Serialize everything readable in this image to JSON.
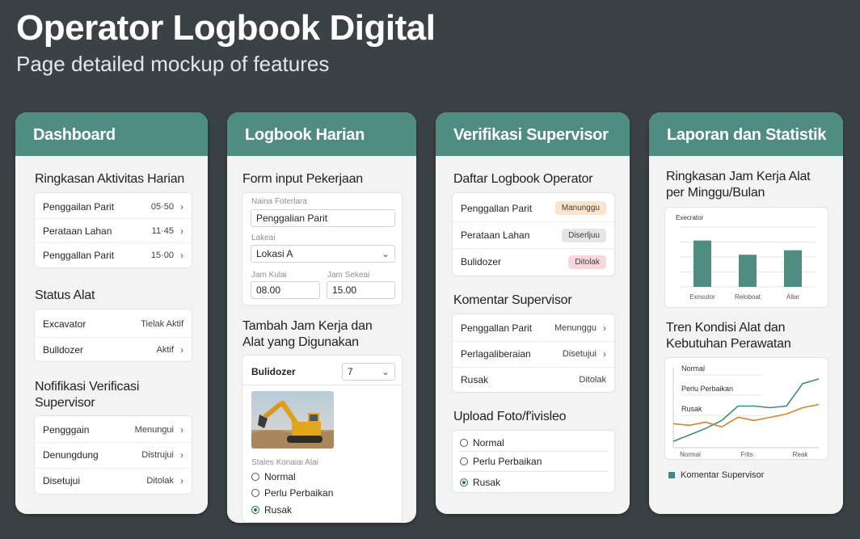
{
  "hero": {
    "title": "Operator Logbook Digital",
    "subtitle": "Page detailed mockup of features"
  },
  "colors": {
    "accent": "#4f8d83",
    "background": "#3b4245",
    "orange": "#d9822b"
  },
  "dashboard": {
    "header": "Dashboard",
    "activity_title": "Ringkasan Aktivitas Harian",
    "activities": [
      {
        "name": "Penggailan Parit",
        "value": "05·50"
      },
      {
        "name": "Perataan Lahan",
        "value": "11·45"
      },
      {
        "name": "Penggallan Parit",
        "value": "15·00"
      }
    ],
    "status_title": "Status Alat",
    "statuses": [
      {
        "name": "Excavator",
        "value": "Tielak Aktif"
      },
      {
        "name": "Bulldozer",
        "value": "Aktif"
      }
    ],
    "notif_title": "Nofifikasi Verificasi Supervisor",
    "notifs": [
      {
        "name": "Pengggain",
        "value": "Menungui"
      },
      {
        "name": "Denungdung",
        "value": "Distrujui"
      },
      {
        "name": "Disetujui",
        "value": "Ditolak"
      }
    ]
  },
  "logbook": {
    "header": "Logbook Harian",
    "form_title": "Form input Pekerjaan",
    "job_label": "Naina Foterlara",
    "job_value": "Penggalian Parit",
    "location_label": "Lakeai",
    "location_value": "Lokasi A",
    "start_label": "Jam Kulai",
    "start_value": "08.00",
    "end_label": "Jam Sekeai",
    "end_value": "15.00",
    "equip_title": "Tambah Jam Kerja dan Alat yang Digunakan",
    "equip_name": "Bulidozer",
    "equip_hours": "7",
    "condition_label": "Stales Konaiai Alai",
    "conditions": [
      "Normal",
      "Perlu Perbaikan",
      "Rusak"
    ],
    "condition_selected": 2
  },
  "verifikasi": {
    "header": "Verifikasi Supervisor",
    "list_title": "Daftar Logbook Operator",
    "items": [
      {
        "name": "Penggallan Parit",
        "badge": "Manunggu",
        "color": "#fbe3cc"
      },
      {
        "name": "Perataan Lahan",
        "badge": "Diserljuu",
        "color": "#e4e6e7"
      },
      {
        "name": "Bulidozer",
        "badge": "Ditolak",
        "color": "#f8d7dc"
      }
    ],
    "comment_title": "Komentar Supervisor",
    "comments": [
      {
        "name": "Penggallan Parit",
        "value": "Menunggu",
        "chevron": true
      },
      {
        "name": "Perlagaliberaian",
        "value": "Disetujui",
        "chevron": true
      },
      {
        "name": "Rusak",
        "value": "Ditolak",
        "chevron": false
      }
    ],
    "upload_title": "Upload Foto/f'ivisleo",
    "upload_options": [
      "Normal",
      "Perlu Perbaikan",
      "Rusak"
    ],
    "upload_selected": 2
  },
  "laporan": {
    "header": "Laporan dan Statistik",
    "bar_title": "Ringkasan Jam Kerja Alat per Minggu/Bulan",
    "trend_title": "Tren Kondisi Alat dan Kebutuhan Perawatan",
    "legend": "Komentar Supervisor"
  },
  "chart_data": [
    {
      "type": "bar",
      "title": "Execrator",
      "categories": [
        "Exnsutor",
        "Reloboat",
        "Allar"
      ],
      "values": [
        62,
        43,
        49
      ],
      "ylim": [
        0,
        80
      ],
      "grid": true
    },
    {
      "type": "line",
      "categories": [
        "Normal",
        "Frits",
        "Reak"
      ],
      "y_labels": [
        "Normal",
        "Perlu Perbaikan",
        "Rusak"
      ],
      "x": [
        0,
        1,
        2,
        3,
        4,
        5,
        6,
        7,
        8,
        9
      ],
      "series": [
        {
          "color": "#3f8a7f",
          "values": [
            0.4,
            0.8,
            1.2,
            1.7,
            2.6,
            2.6,
            2.5,
            2.6,
            4.0,
            4.3
          ]
        },
        {
          "color": "#d9822b",
          "values": [
            1.5,
            1.4,
            1.6,
            1.3,
            1.9,
            1.7,
            1.9,
            2.1,
            2.5,
            2.7
          ]
        }
      ],
      "ylim": [
        0,
        5
      ],
      "legend": "bottom-left"
    }
  ]
}
